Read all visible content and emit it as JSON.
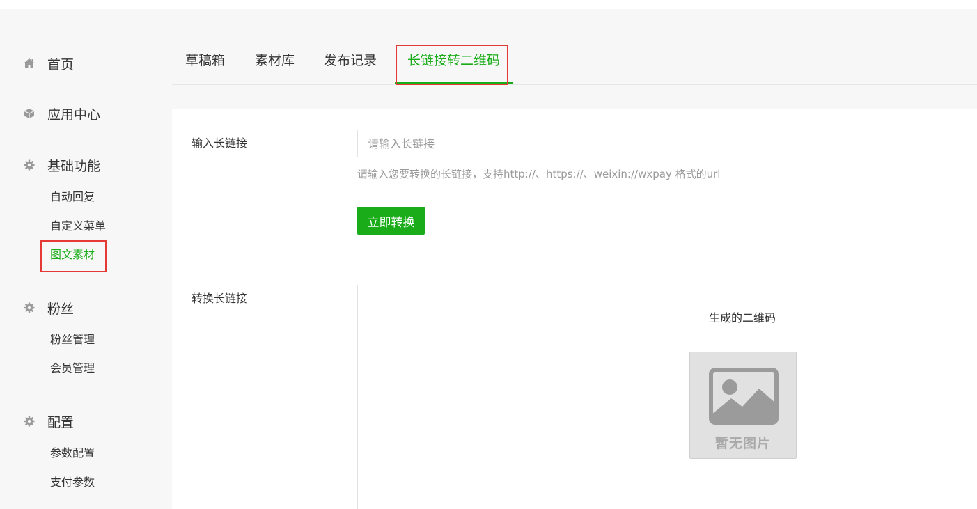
{
  "sidebar": {
    "home": {
      "label": "首页",
      "icon": "home-icon"
    },
    "app_center": {
      "label": "应用中心",
      "icon": "cube-icon"
    },
    "basic": {
      "label": "基础功能",
      "icon": "gear-icon",
      "items": [
        "自动回复",
        "自定义菜单",
        "图文素材"
      ],
      "active_item": "图文素材"
    },
    "fans": {
      "label": "粉丝",
      "icon": "gear-icon",
      "items": [
        "粉丝管理",
        "会员管理"
      ]
    },
    "config": {
      "label": "配置",
      "icon": "gear-icon",
      "items": [
        "参数配置",
        "支付参数"
      ]
    }
  },
  "tabs": {
    "items": [
      "草稿箱",
      "素材库",
      "发布记录",
      "长链接转二维码"
    ],
    "active": "长链接转二维码"
  },
  "form": {
    "input_label": "输入长链接",
    "input_placeholder": "请输入长链接",
    "input_value": "",
    "hint": "请输入您要转换的长链接，支持http://、https://、weixin://wxpay 格式的url",
    "button_label": "立即转换",
    "result_label": "转换长链接",
    "qr_title": "生成的二维码",
    "no_image_text": "暂无图片"
  },
  "colors": {
    "accent": "#1aad19",
    "highlight": "#e53935",
    "background": "#f7f7f7"
  }
}
